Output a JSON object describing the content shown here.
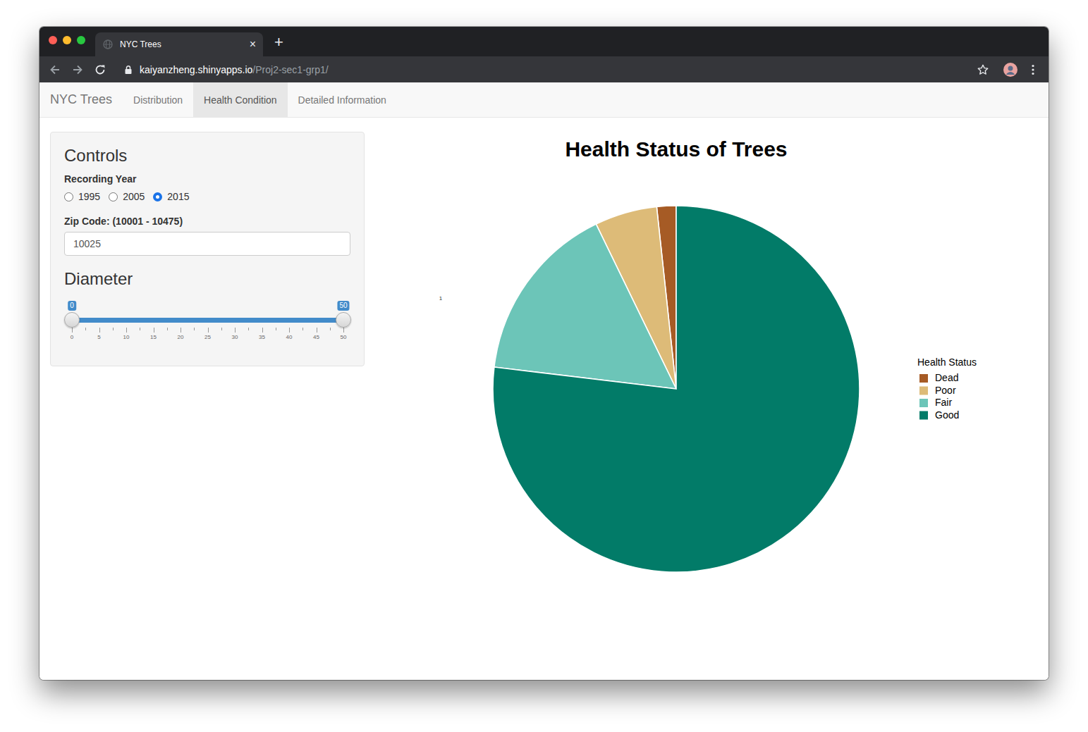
{
  "window": {
    "title": "NYC Trees",
    "close": "×",
    "new_tab": "+",
    "url_host": "kaiyanzheng.shinyapps.io",
    "url_path": "/Proj2-sec1-grp1/"
  },
  "navbar": {
    "brand": "NYC Trees",
    "tabs": [
      {
        "label": "Distribution",
        "selected": false
      },
      {
        "label": "Health Condition",
        "selected": true
      },
      {
        "label": "Detailed Information",
        "selected": false
      }
    ]
  },
  "controls": {
    "heading": "Controls",
    "year": {
      "label": "Recording Year",
      "options": [
        {
          "label": "1995",
          "selected": false
        },
        {
          "label": "2005",
          "selected": false
        },
        {
          "label": "2015",
          "selected": true
        }
      ]
    },
    "zip": {
      "label": "Zip Code: (10001 - 10475)",
      "value": "10025"
    }
  },
  "diameter": {
    "heading": "Diameter",
    "slider": {
      "low_label": "0",
      "high_label": "50",
      "low_level": 0,
      "high_level": 1,
      "ticks": [
        "0",
        "5",
        "10",
        "15",
        "20",
        "25",
        "30",
        "35",
        "40",
        "45",
        "50"
      ]
    }
  },
  "chart": {
    "title": "Health Status of Trees",
    "stray_label": "1",
    "legend_title": "Health Status",
    "slices": [
      {
        "name": "Dead",
        "value": 1.7,
        "color": "#a65b25"
      },
      {
        "name": "Poor",
        "value": 5.5,
        "color": "#ddbb78"
      },
      {
        "name": "Fair",
        "value": 15.9,
        "color": "#6cc5b8"
      },
      {
        "name": "Good",
        "value": 76.9,
        "color": "#027b68"
      }
    ]
  }
}
